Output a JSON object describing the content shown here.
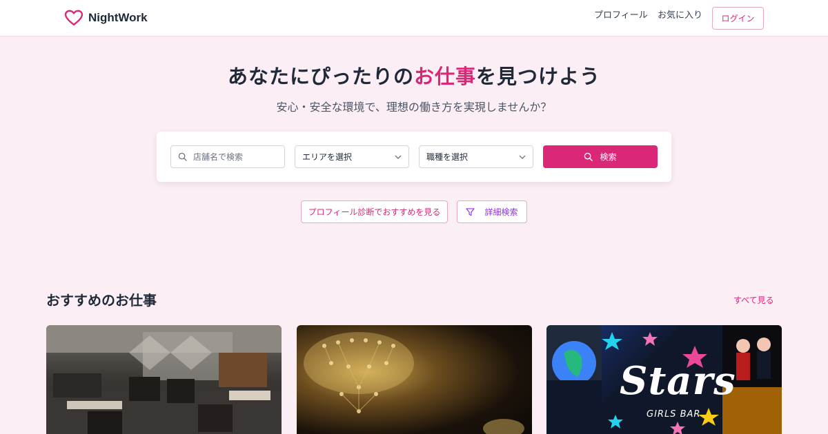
{
  "header": {
    "logo_text": "NightWork",
    "nav": {
      "profile": "プロフィール",
      "favorites": "お気に入り"
    },
    "login": "ログイン"
  },
  "hero": {
    "title_before": "あなたにぴったりの",
    "title_accent": "お仕事",
    "title_after": "を見つけよう",
    "subtitle": "安心・安全な環境で、理想の働き方を実現しませんか？"
  },
  "search": {
    "placeholder": "店舗名で検索",
    "area_select": "エリアを選択",
    "job_select": "職種を選択",
    "button": "検索"
  },
  "actions": {
    "diagnosis": "プロフィール診断でおすすめを見る",
    "advanced": "詳細検索"
  },
  "recommended": {
    "title": "おすすめのお仕事",
    "see_all": "すべて見る",
    "cards": [
      {
        "image": "lounge-interior"
      },
      {
        "image": "chandelier"
      },
      {
        "image": "stars-girls-bar",
        "logo_text": "Stars",
        "logo_sub": "GIRLS BAR"
      }
    ]
  },
  "colors": {
    "accent": "#db2777",
    "background": "#fbeef5",
    "purple": "#9333ea"
  }
}
